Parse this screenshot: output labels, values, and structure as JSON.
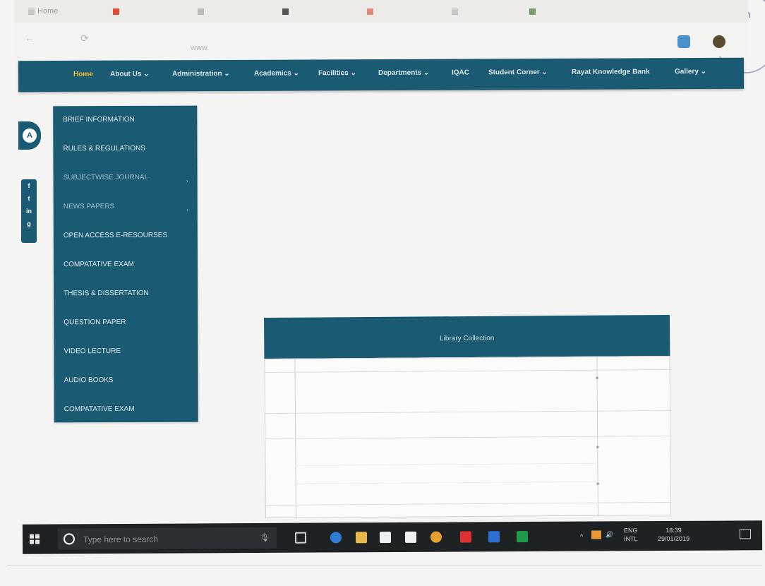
{
  "browser": {
    "tabs": [
      "Home",
      "",
      "",
      "",
      "",
      "",
      ""
    ],
    "url": "www.",
    "nav_back": "←",
    "nav_reload": "⟳"
  },
  "site_nav": {
    "items": [
      {
        "label": "Home",
        "active": true
      },
      {
        "label": "About Us ⌄"
      },
      {
        "label": "Administration ⌄"
      },
      {
        "label": "Academics ⌄"
      },
      {
        "label": "Facilities ⌄"
      },
      {
        "label": "Departments ⌄"
      },
      {
        "label": "IQAC"
      },
      {
        "label": "Student Corner ⌄"
      },
      {
        "label": "Rayat Knowledge Bank"
      },
      {
        "label": "Gallery ⌄"
      }
    ]
  },
  "float_widget": {
    "glyph": "A"
  },
  "social": {
    "items": [
      "f",
      "t",
      "in",
      "g"
    ]
  },
  "sidebar": {
    "items": [
      {
        "label": "BRIEF INFORMATION"
      },
      {
        "label": "RULES & REGULATIONS"
      },
      {
        "label": "SUBJECTWISE JOURNAL",
        "has_submenu": true
      },
      {
        "label": "NEWS PAPERS",
        "has_submenu": true
      },
      {
        "label": "OPEN ACCESS E-RESOURSES"
      },
      {
        "label": "COMPATATIVE EXAM"
      },
      {
        "label": "THESIS & DISSERTATION"
      },
      {
        "label": "QUESTION PAPER"
      },
      {
        "label": "VIDEO LECTURE"
      },
      {
        "label": "AUDIO BOOKS"
      },
      {
        "label": "COMPATATIVE EXAM"
      }
    ]
  },
  "library": {
    "title": "Library Collection"
  },
  "taskbar": {
    "search_placeholder": "Type here to search",
    "language": "ENG",
    "locale": "INTL",
    "time": "18:39",
    "date": "29/01/2019"
  },
  "seal": {
    "text": "Sh"
  },
  "colors": {
    "brand": "#1b5a73",
    "active_nav": "#f2c229"
  }
}
